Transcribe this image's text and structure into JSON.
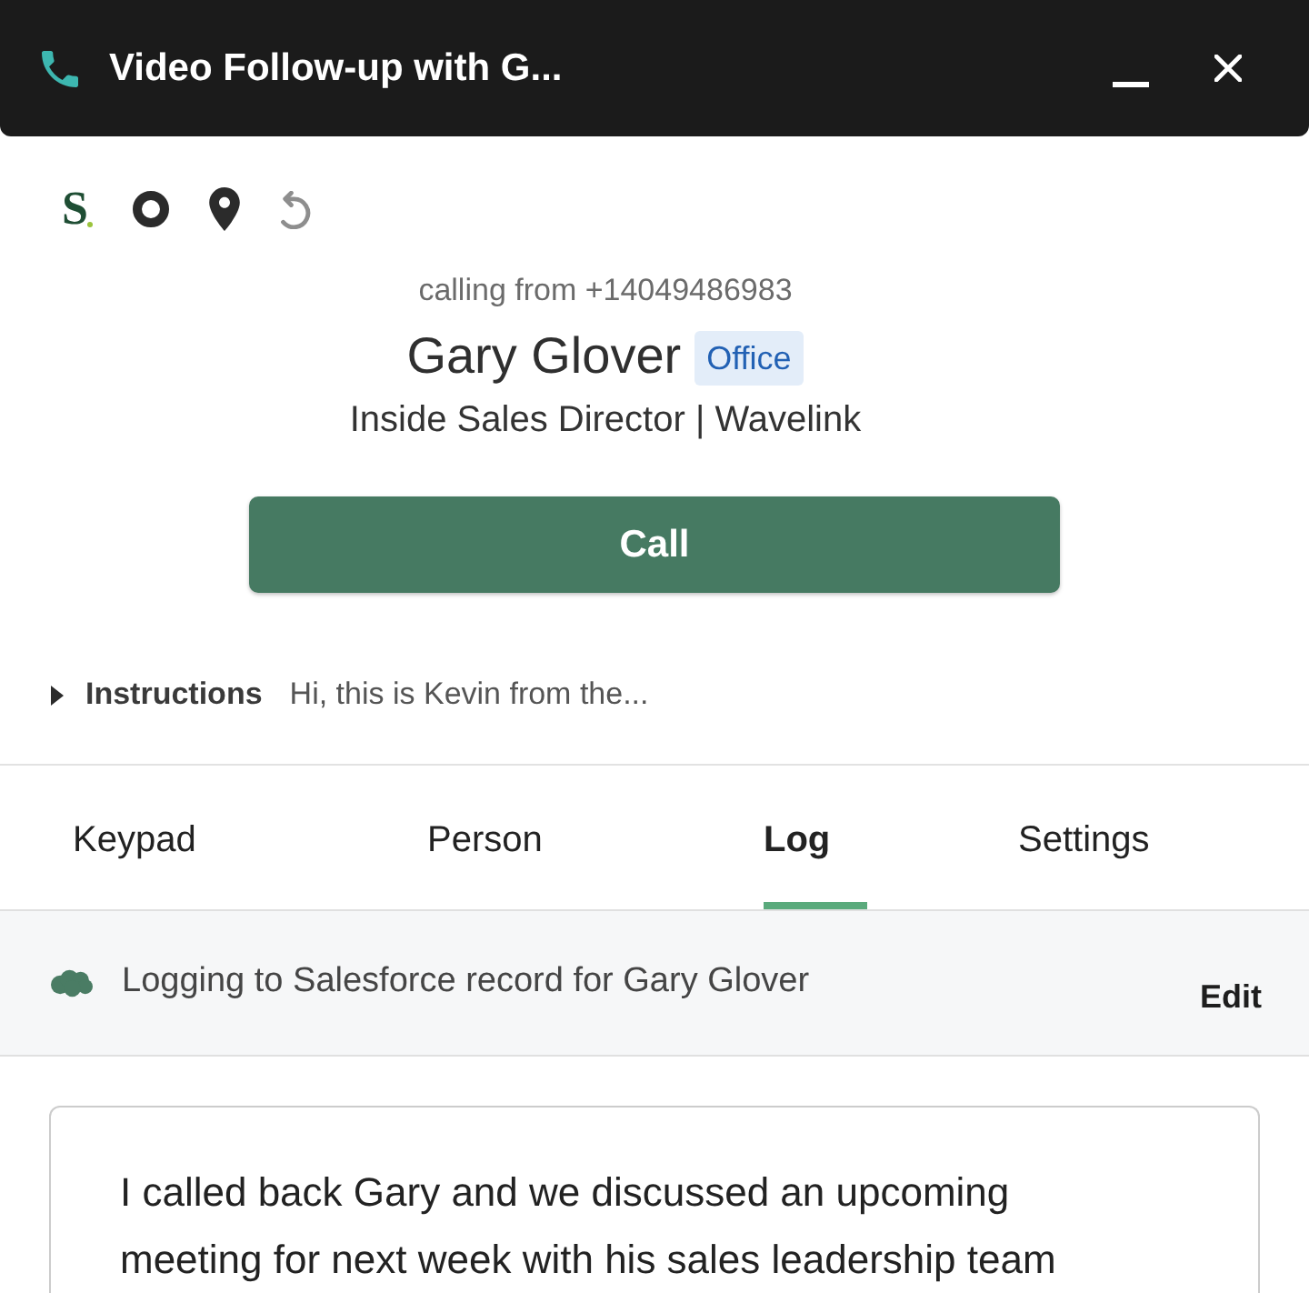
{
  "window": {
    "title": "Video Follow-up with G..."
  },
  "toolbar": {
    "logo": "S",
    "tools": [
      {
        "kind": "ring",
        "disabled": false
      },
      {
        "kind": "pin",
        "disabled": false
      },
      {
        "kind": "undo",
        "disabled": true
      }
    ]
  },
  "contact": {
    "calling_from": "calling from +14049486983",
    "name": "Gary Glover",
    "badge": "Office",
    "title": "Inside Sales Director | Wavelink"
  },
  "call_button": {
    "label": "Call"
  },
  "instructions": {
    "label": "Instructions",
    "preview": "Hi, this is Kevin from the...",
    "expanded": false
  },
  "tabs": [
    {
      "label": "Keypad",
      "selected": false
    },
    {
      "label": "Person",
      "selected": false
    },
    {
      "label": "Log",
      "selected": true
    },
    {
      "label": "Settings",
      "selected": false
    }
  ],
  "logging": {
    "text": "Logging to Salesforce record for Gary Glover",
    "action": "Edit"
  },
  "notes": {
    "value": "I called back Gary and we discussed an upcoming meeting for next week with his sales leadership team"
  }
}
